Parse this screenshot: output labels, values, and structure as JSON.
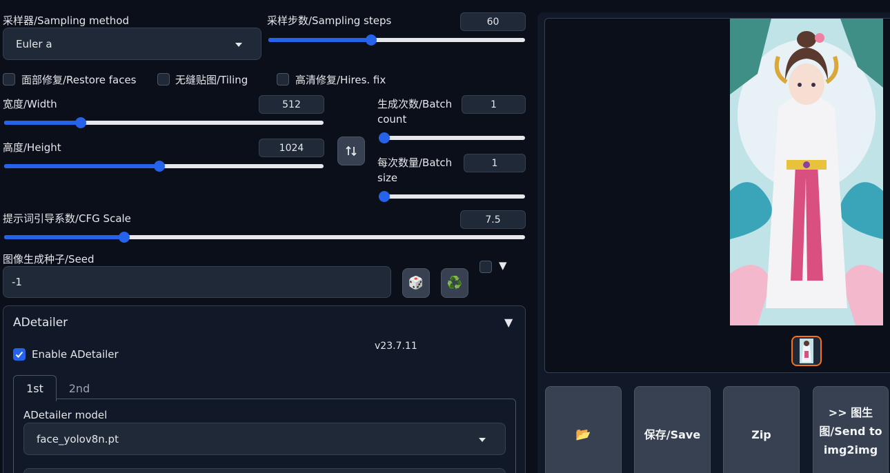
{
  "sampling": {
    "method_label": "采样器/Sampling method",
    "method_value": "Euler a",
    "steps_label": "采样步数/Sampling steps",
    "steps_value": "60",
    "steps_fraction": 0.4
  },
  "checkboxes": {
    "restore_faces": "面部修复/Restore faces",
    "tiling": "无缝贴图/Tiling",
    "hires_fix": "高清修复/Hires. fix"
  },
  "dimensions": {
    "width_label": "宽度/Width",
    "width_value": "512",
    "width_fraction": 0.24,
    "height_label": "高度/Height",
    "height_value": "1024",
    "height_fraction": 0.487
  },
  "batch": {
    "count_label": "生成次数/Batch count",
    "count_value": "1",
    "count_fraction": 0.0,
    "size_label": "每次数量/Batch size",
    "size_value": "1",
    "size_fraction": 0.0
  },
  "cfg": {
    "label": "提示词引导系数/CFG Scale",
    "value": "7.5",
    "fraction": 0.23
  },
  "seed": {
    "label": "图像生成种子/Seed",
    "value": "-1",
    "dice_icon": "🎲",
    "recycle_icon": "♻️",
    "extra_toggle": "▼"
  },
  "adetailer": {
    "title": "ADetailer",
    "collapse_icon": "▼",
    "enable_label": "Enable ADetailer",
    "version": "v23.7.11",
    "tabs": [
      "1st",
      "2nd"
    ],
    "model_label": "ADetailer model",
    "model_value": "face_yolov8n.pt"
  },
  "output_actions": {
    "folder_icon": "📂",
    "save_label": "保存/Save",
    "zip_label": "Zip",
    "send_img2img_label": ">> 图生图/Send to img2img"
  },
  "colors": {
    "accent": "#2563eb",
    "background": "#0b0f19",
    "panel": "#1f2937",
    "thumbnail_border": "#f97316"
  }
}
